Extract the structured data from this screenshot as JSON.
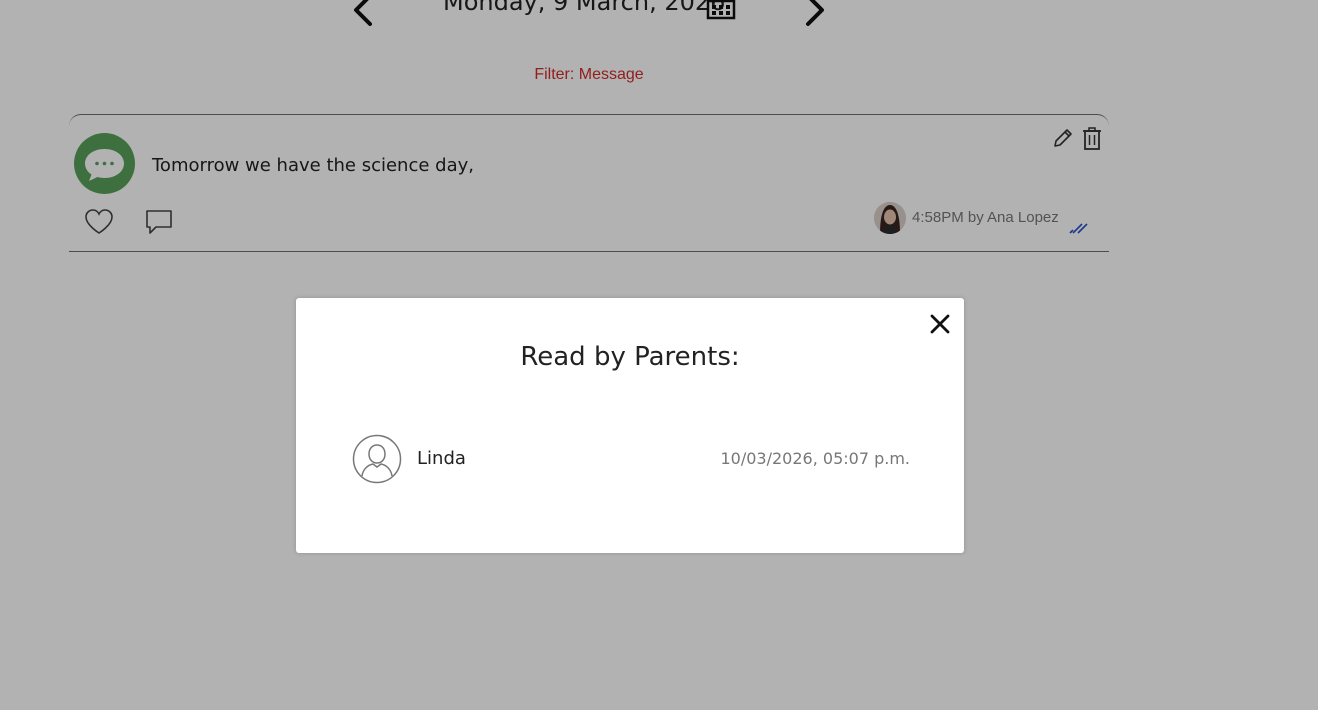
{
  "header": {
    "date": "Monday, 9 March, 2026",
    "filter": "Filter: Message"
  },
  "message": {
    "text": "Tomorrow we have the science day,",
    "meta": "4:58PM by Ana Lopez"
  },
  "modal": {
    "title": "Read by Parents:",
    "readers": [
      {
        "name": "Linda",
        "time": "10/03/2026, 05:07 p.m."
      }
    ]
  },
  "icons": {
    "prev": "chevron-left-icon",
    "next": "chevron-right-icon",
    "calendar": "calendar-icon",
    "edit": "pencil-icon",
    "delete": "trash-icon",
    "like": "heart-icon",
    "comment": "comment-icon",
    "read": "double-check-icon",
    "close": "close-icon",
    "user": "user-icon"
  },
  "colors": {
    "filter": "#d12b2b",
    "message_avatar": "#5aa05a",
    "read_check": "#2a4fc8"
  }
}
